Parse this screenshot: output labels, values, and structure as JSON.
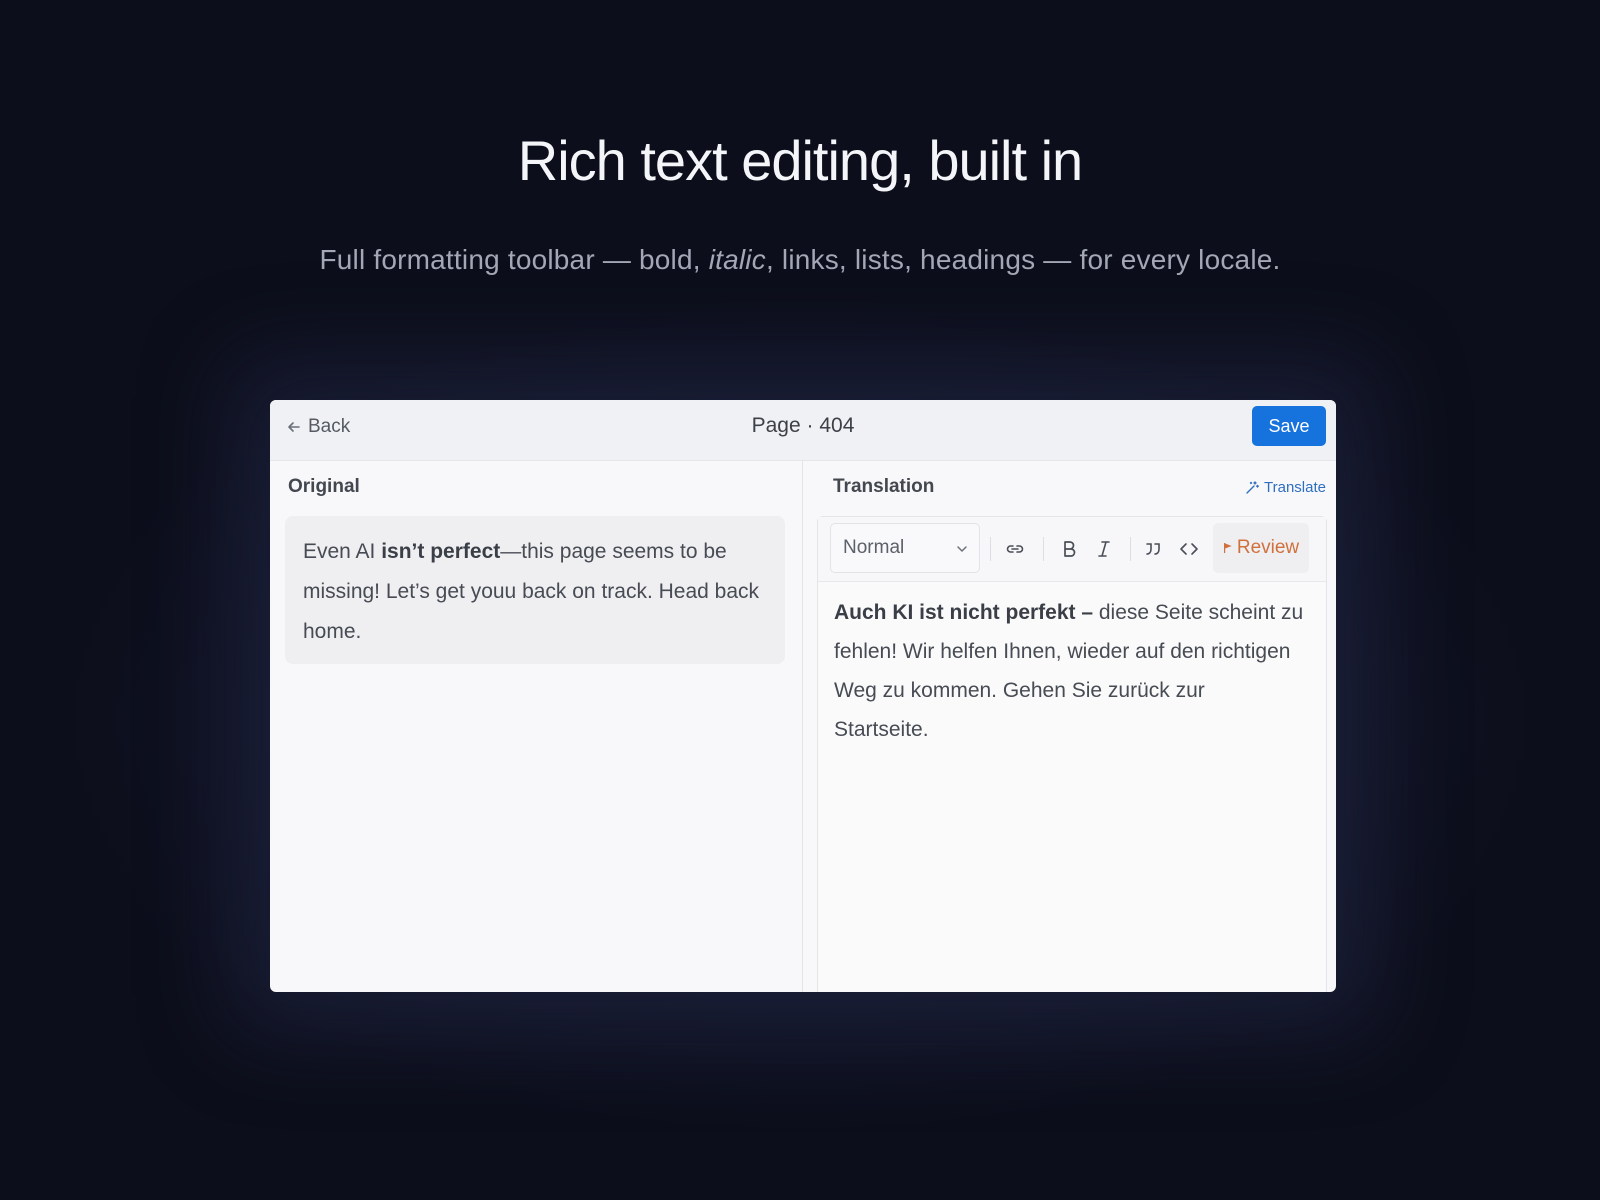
{
  "hero": {
    "title": "Rich text editing, built in",
    "subtitle_before": "Full formatting toolbar — bold, ",
    "subtitle_italic": "italic",
    "subtitle_after": ", links, lists, headings — for every locale."
  },
  "header": {
    "back_label": "Back",
    "page_title": "Page · 404",
    "save_label": "Save"
  },
  "original": {
    "label": "Original",
    "text_part1": "Even AI ",
    "text_bold": "isn’t perfect",
    "text_part2": "—this page seems to be missing! Let’s get youu back on track. Head back home."
  },
  "translation": {
    "label": "Translation",
    "translate_action": "Translate",
    "style_select_value": "Normal",
    "review_label": "Review",
    "text_bold": "Auch KI ist nicht perfekt –",
    "text_rest": " diese Seite scheint zu fehlen! Wir helfen Ihnen, wieder auf den richtigen Weg zu kommen. Gehen Sie zurück zur Startseite."
  },
  "icons": {
    "back": "arrow-left-icon",
    "translate": "magic-wand-icon",
    "dropdown": "chevron-down-icon",
    "link": "link-icon",
    "bold": "bold-icon",
    "italic": "italic-icon",
    "quote": "quote-icon",
    "code": "code-icon",
    "review": "flag-icon"
  },
  "colors": {
    "accent": "#1672dd",
    "review": "#d0703c",
    "link": "#2f6fc0"
  }
}
